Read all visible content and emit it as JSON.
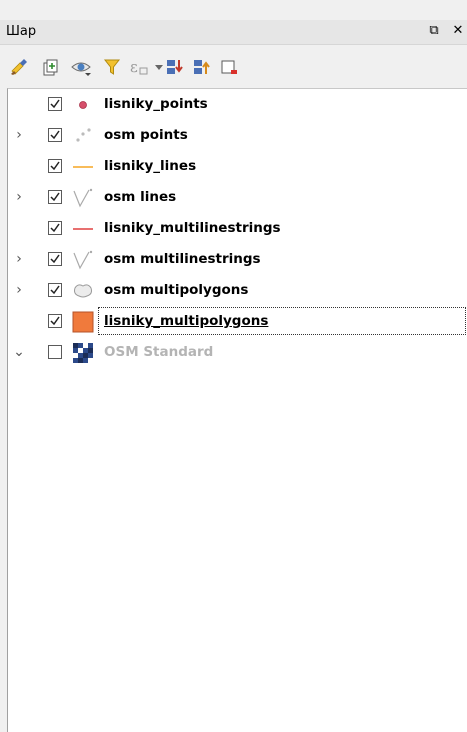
{
  "panel": {
    "title": "Шар",
    "float_icon": "⧉",
    "close_icon": "✕"
  },
  "toolbar": {
    "items": [
      {
        "icon": "style-brush-icon"
      },
      {
        "icon": "add-group-icon"
      },
      {
        "icon": "visibility-eye-icon"
      },
      {
        "icon": "filter-funnel-icon"
      },
      {
        "icon": "expression-filter-icon"
      },
      {
        "icon": "dropdown-arrow-icon"
      },
      {
        "icon": "expand-all-icon"
      },
      {
        "icon": "collapse-all-icon"
      },
      {
        "icon": "remove-layer-icon"
      }
    ]
  },
  "layers": [
    {
      "name": "lisniky_points",
      "checked": true,
      "expander": "",
      "symbol": "point-red"
    },
    {
      "name": "osm points",
      "checked": true,
      "expander": "›",
      "symbol": "points-gray"
    },
    {
      "name": "lisniky_lines",
      "checked": true,
      "expander": "",
      "symbol": "line-orange"
    },
    {
      "name": "osm lines",
      "checked": true,
      "expander": "›",
      "symbol": "line-gray-v"
    },
    {
      "name": "lisniky_multilinestrings",
      "checked": true,
      "expander": "",
      "symbol": "line-red"
    },
    {
      "name": "osm multilinestrings",
      "checked": true,
      "expander": "›",
      "symbol": "line-gray-v"
    },
    {
      "name": "osm multipolygons",
      "checked": true,
      "expander": "›",
      "symbol": "polygon-gray"
    },
    {
      "name": "lisniky_multipolygons",
      "checked": true,
      "expander": "",
      "symbol": "polygon-orange",
      "selected": true
    },
    {
      "name": "OSM Standard",
      "checked": false,
      "expander": "⌄",
      "symbol": "raster",
      "disabled": true
    }
  ],
  "colors": {
    "point": "#d64f6b",
    "line_orange": "#f5a623",
    "line_red": "#e04040",
    "polygon_orange": "#f07a3c",
    "disabled_text": "#b4b4b4"
  }
}
